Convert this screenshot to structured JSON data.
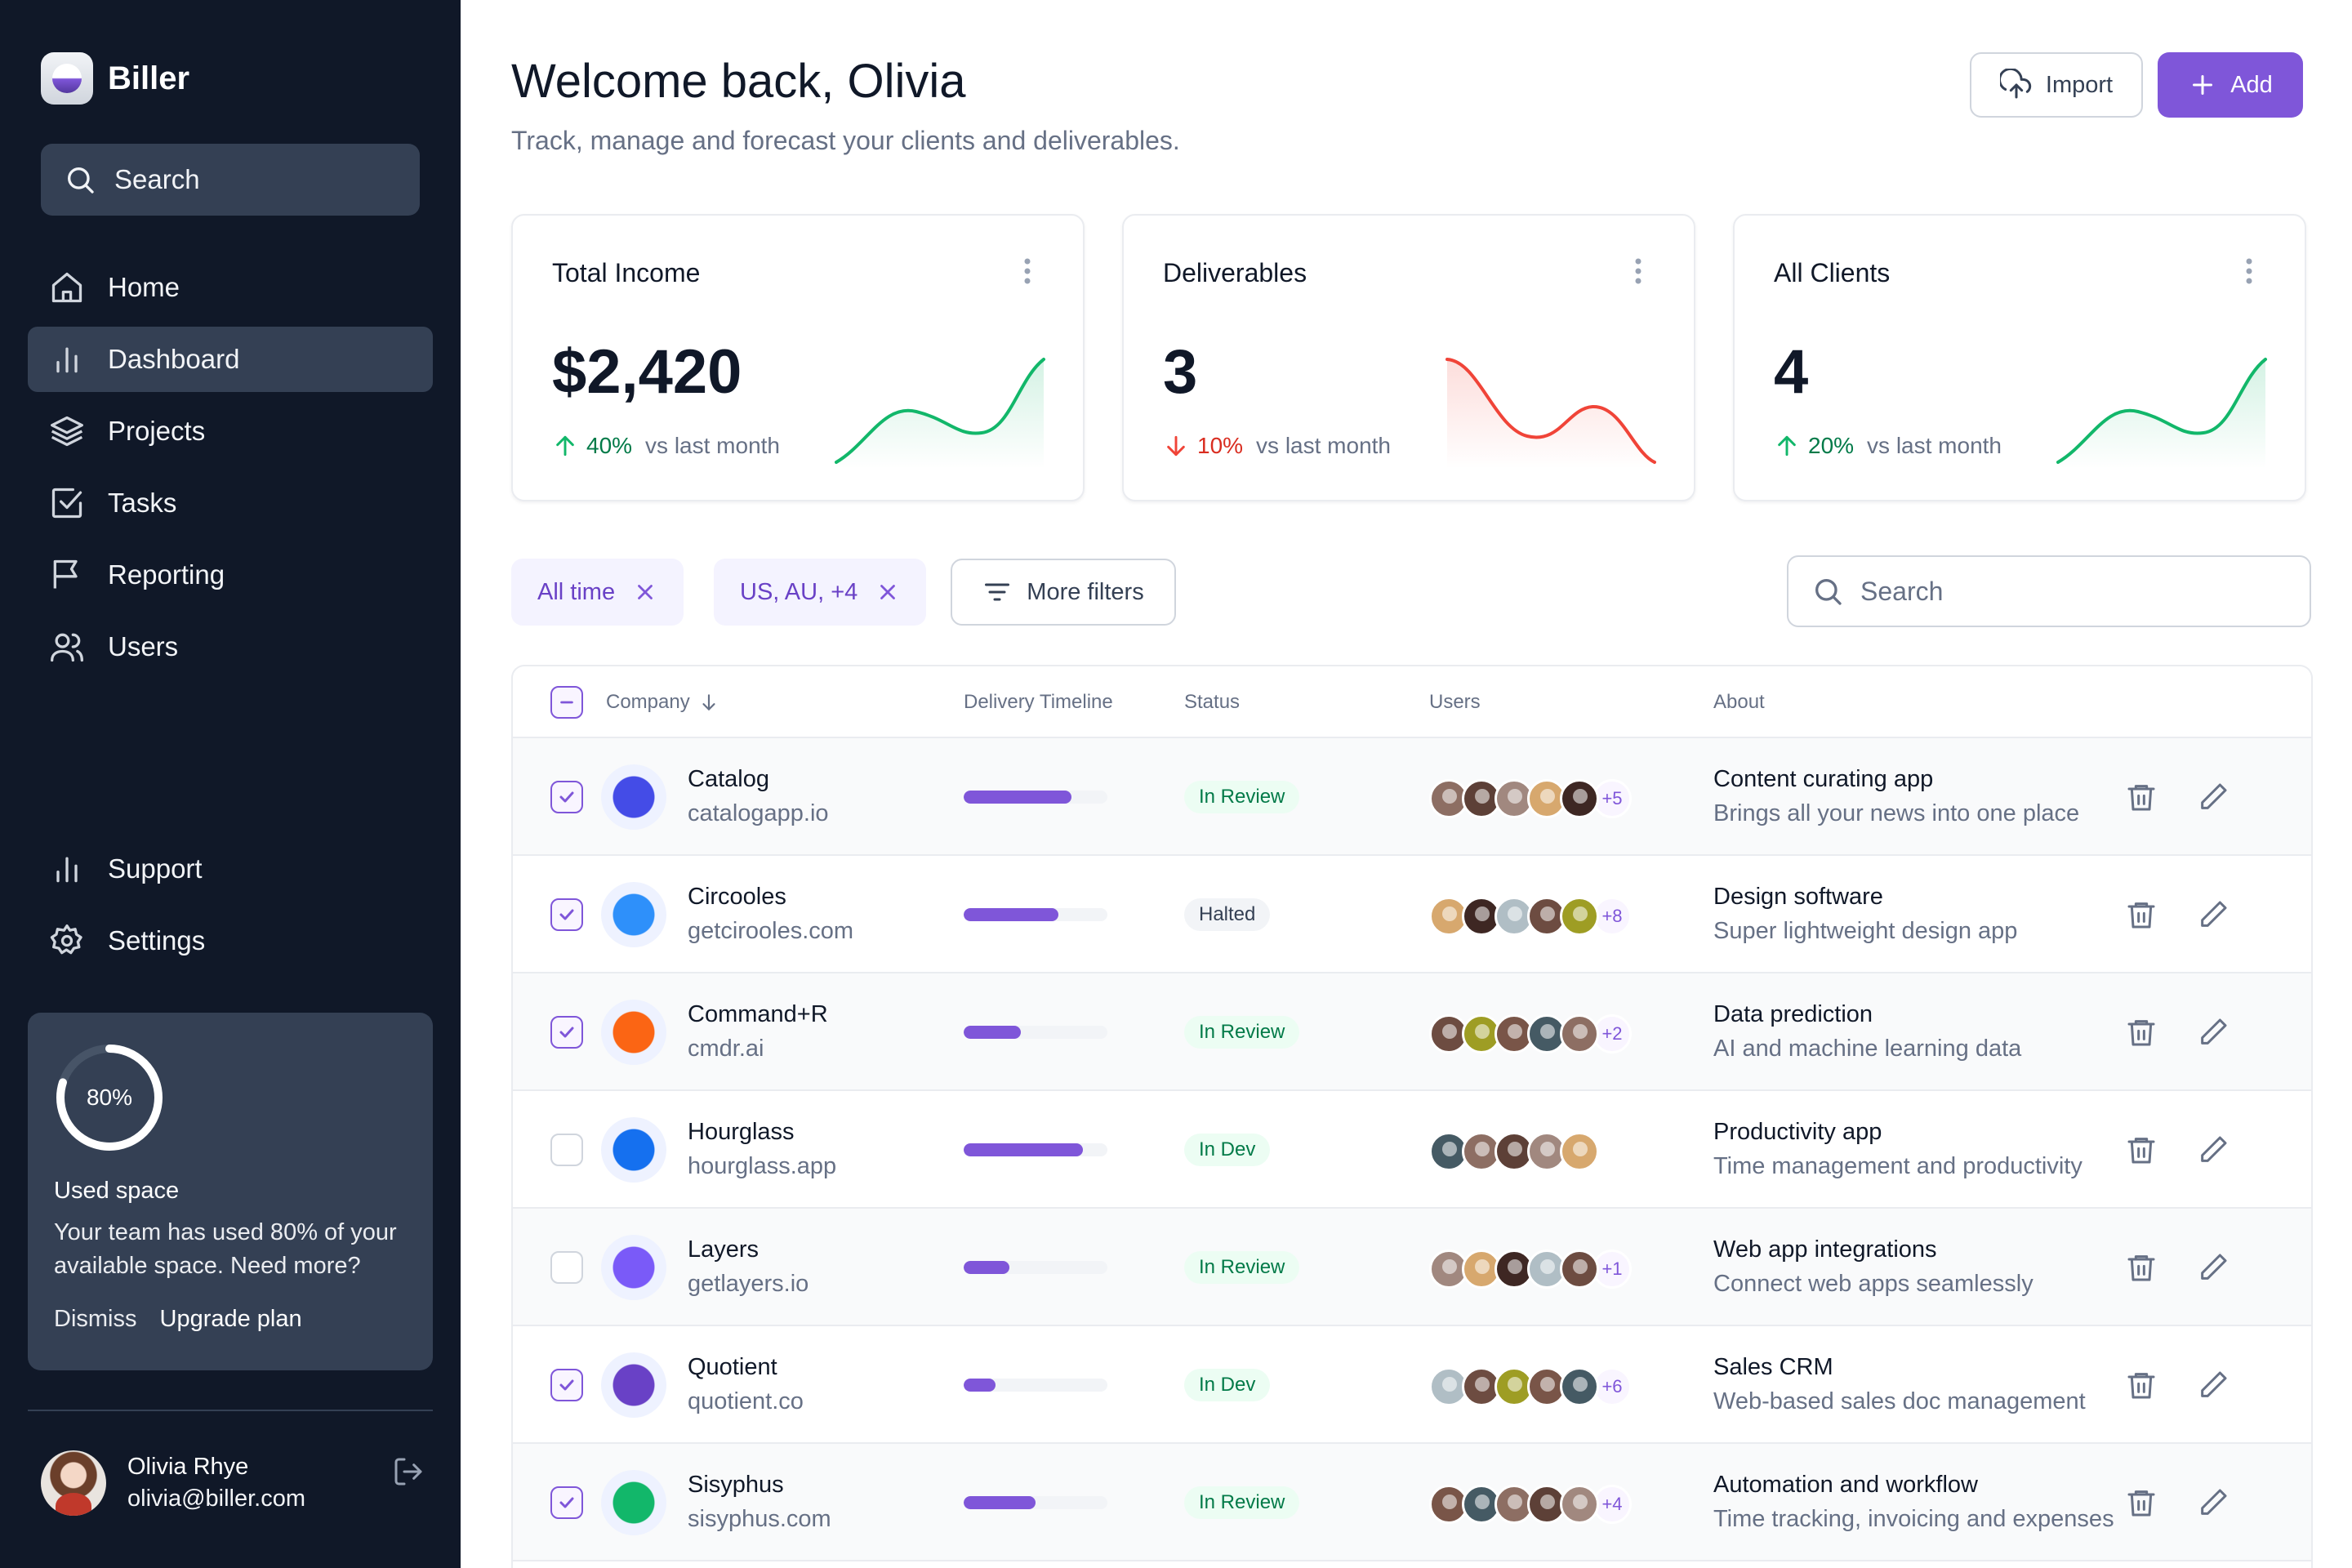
{
  "brand": {
    "name": "Biller"
  },
  "sidebar": {
    "search_placeholder": "Search",
    "nav": [
      {
        "label": "Home",
        "icon": "home-icon"
      },
      {
        "label": "Dashboard",
        "icon": "bar-chart-icon",
        "active": true
      },
      {
        "label": "Projects",
        "icon": "layers-icon"
      },
      {
        "label": "Tasks",
        "icon": "check-square-icon"
      },
      {
        "label": "Reporting",
        "icon": "flag-icon"
      },
      {
        "label": "Users",
        "icon": "users-icon"
      }
    ],
    "footer_nav": [
      {
        "label": "Support",
        "icon": "bar-chart-icon"
      },
      {
        "label": "Settings",
        "icon": "gear-icon"
      }
    ],
    "space": {
      "percent_label": "80%",
      "used_fraction": 0.8,
      "title": "Used space",
      "text": "Your team has used 80% of your available space. Need more?",
      "dismiss": "Dismiss",
      "upgrade": "Upgrade plan"
    },
    "user": {
      "name": "Olivia Rhye",
      "email": "olivia@biller.com"
    }
  },
  "header": {
    "title": "Welcome back, Olivia",
    "subtitle": "Track, manage and forecast your clients and deliverables.",
    "import_label": "Import",
    "add_label": "Add"
  },
  "stats": [
    {
      "title": "Total Income",
      "value": "$2,420",
      "change": "40%",
      "trend": "up",
      "vs": "vs last month",
      "color": "#12b76a"
    },
    {
      "title": "Deliverables",
      "value": "3",
      "change": "10%",
      "trend": "down",
      "vs": "vs last month",
      "color": "#f04438"
    },
    {
      "title": "All Clients",
      "value": "4",
      "change": "20%",
      "trend": "up",
      "vs": "vs last month",
      "color": "#12b76a"
    }
  ],
  "filters": {
    "chips": [
      "All time",
      "US, AU, +4"
    ],
    "more_filters": "More filters",
    "search_placeholder": "Search"
  },
  "table": {
    "headers": {
      "company": "Company",
      "timeline": "Delivery Timeline",
      "status": "Status",
      "users": "Users",
      "about": "About"
    },
    "rows": [
      {
        "checked": true,
        "name": "Catalog",
        "domain": "catalogapp.io",
        "progress": 0.75,
        "status": "In Review",
        "status_kind": "review",
        "avatar_count": 5,
        "more": "+5",
        "about_title": "Content curating app",
        "about_sub": "Brings all your news into one place",
        "logo_color": "#444ce7"
      },
      {
        "checked": true,
        "name": "Circooles",
        "domain": "getcirooles.com",
        "progress": 0.66,
        "status": "Halted",
        "status_kind": "halted",
        "avatar_count": 5,
        "more": "+8",
        "about_title": "Design software",
        "about_sub": "Super lightweight design app",
        "logo_color": "#2e90fa"
      },
      {
        "checked": true,
        "name": "Command+R",
        "domain": "cmdr.ai",
        "progress": 0.4,
        "status": "In Review",
        "status_kind": "review",
        "avatar_count": 5,
        "more": "+2",
        "about_title": "Data prediction",
        "about_sub": "AI and machine learning data",
        "logo_color": "#fb6514"
      },
      {
        "checked": false,
        "name": "Hourglass",
        "domain": "hourglass.app",
        "progress": 0.83,
        "status": "In Dev",
        "status_kind": "dev",
        "avatar_count": 5,
        "more": "",
        "about_title": "Productivity app",
        "about_sub": "Time management and productivity",
        "logo_color": "#1570ef"
      },
      {
        "checked": false,
        "name": "Layers",
        "domain": "getlayers.io",
        "progress": 0.32,
        "status": "In Review",
        "status_kind": "review",
        "avatar_count": 5,
        "more": "+1",
        "about_title": "Web app integrations",
        "about_sub": "Connect web apps seamlessly",
        "logo_color": "#7a5af8"
      },
      {
        "checked": true,
        "name": "Quotient",
        "domain": "quotient.co",
        "progress": 0.22,
        "status": "In Dev",
        "status_kind": "dev",
        "avatar_count": 5,
        "more": "+6",
        "about_title": "Sales CRM",
        "about_sub": "Web-based sales doc management",
        "logo_color": "#6941c6"
      },
      {
        "checked": true,
        "name": "Sisyphus",
        "domain": "sisyphus.com",
        "progress": 0.5,
        "status": "In Review",
        "status_kind": "review",
        "avatar_count": 5,
        "more": "+4",
        "about_title": "Automation and workflow",
        "about_sub": "Time tracking, invoicing and expenses",
        "logo_color": "#12b76a"
      }
    ]
  }
}
